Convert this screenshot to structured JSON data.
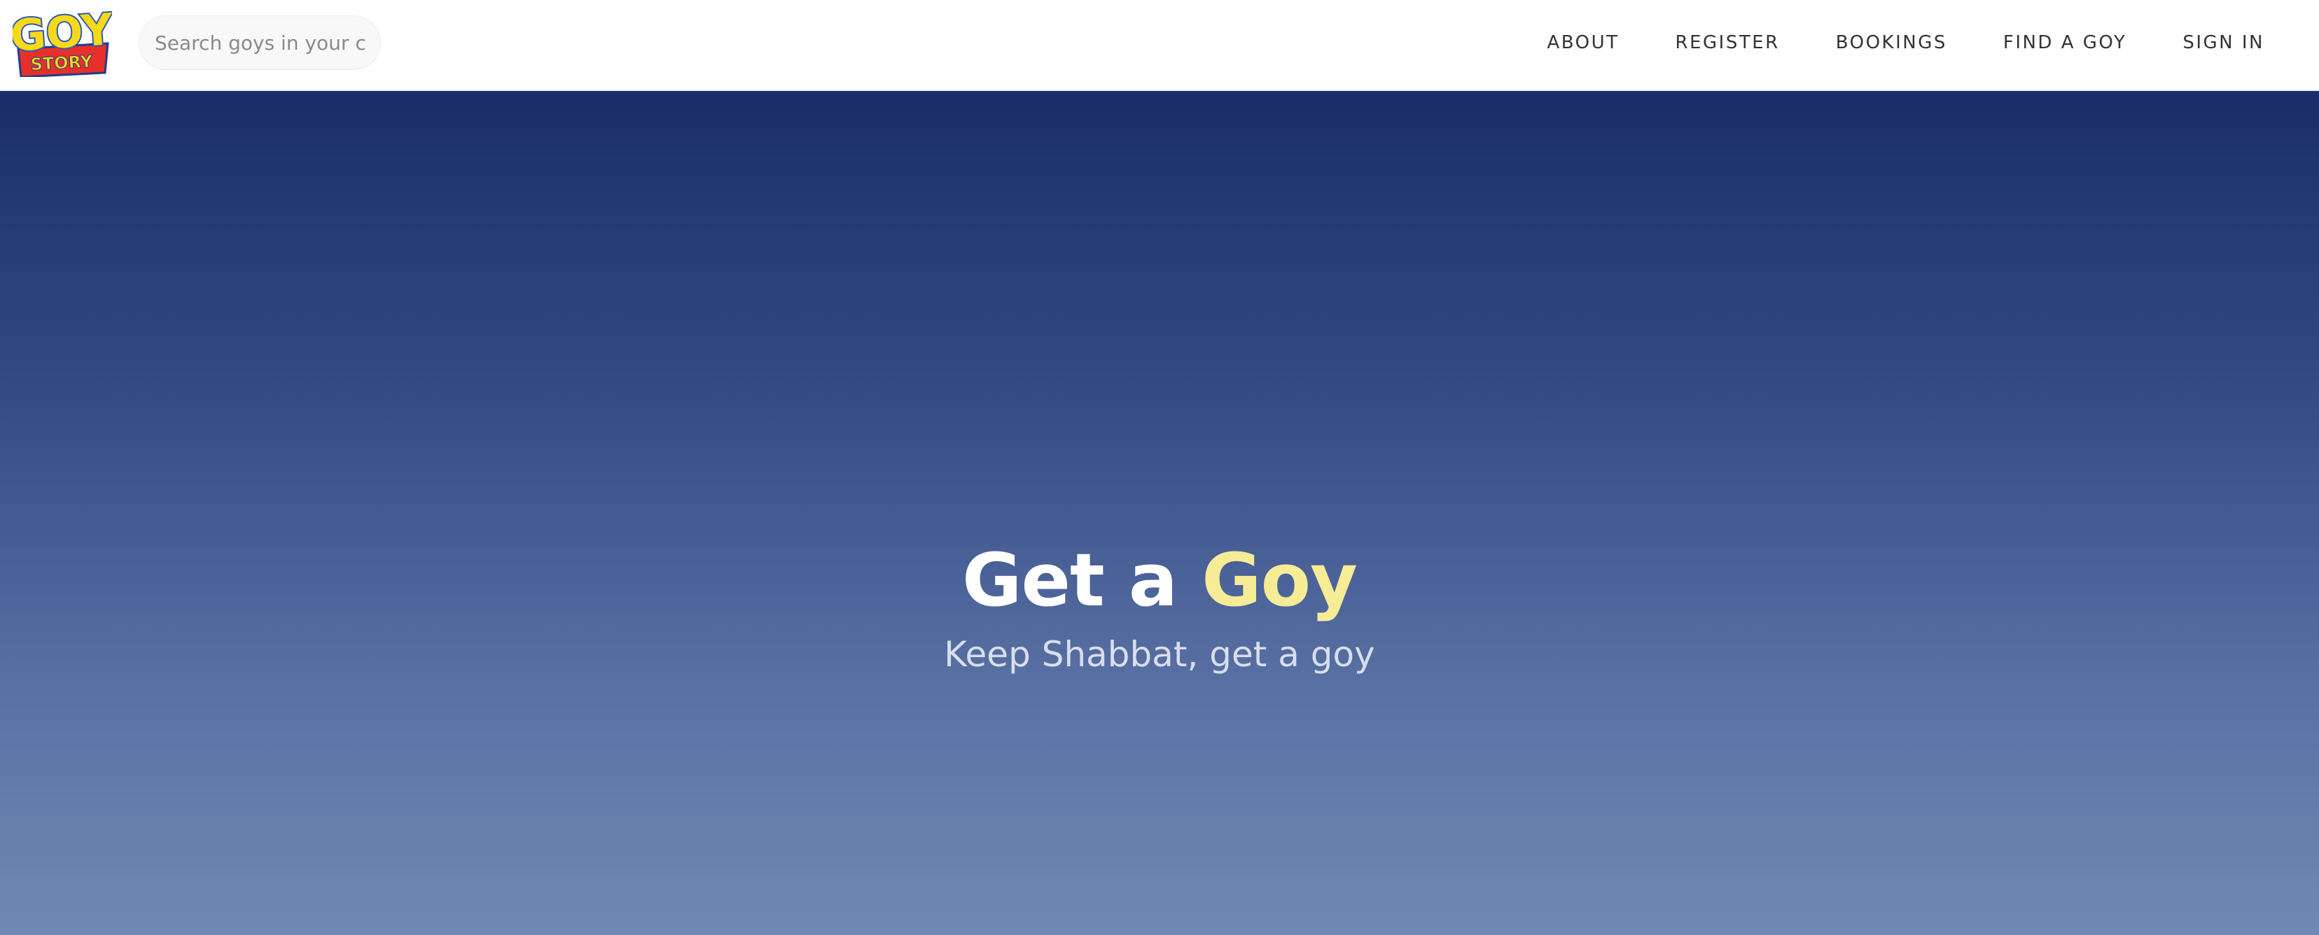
{
  "brand": {
    "logo_line1": "GOY",
    "logo_line2": "STORY"
  },
  "search": {
    "placeholder": "Search goys in your city"
  },
  "nav": {
    "items": [
      {
        "label": "ABOUT"
      },
      {
        "label": "REGISTER"
      },
      {
        "label": "BOOKINGS"
      },
      {
        "label": "FIND A GOY"
      },
      {
        "label": "SIGN IN"
      }
    ]
  },
  "hero": {
    "title_prefix": "Get a ",
    "title_accent": "Goy",
    "subtitle": "Keep Shabbat, get a goy"
  },
  "colors": {
    "hero_top": "#1a2d6a",
    "hero_bottom": "#7089b4",
    "accent_yellow": "#f6ec96",
    "logo_red": "#e8302a",
    "logo_yellow": "#f7d917",
    "logo_blue": "#2e59b8"
  }
}
